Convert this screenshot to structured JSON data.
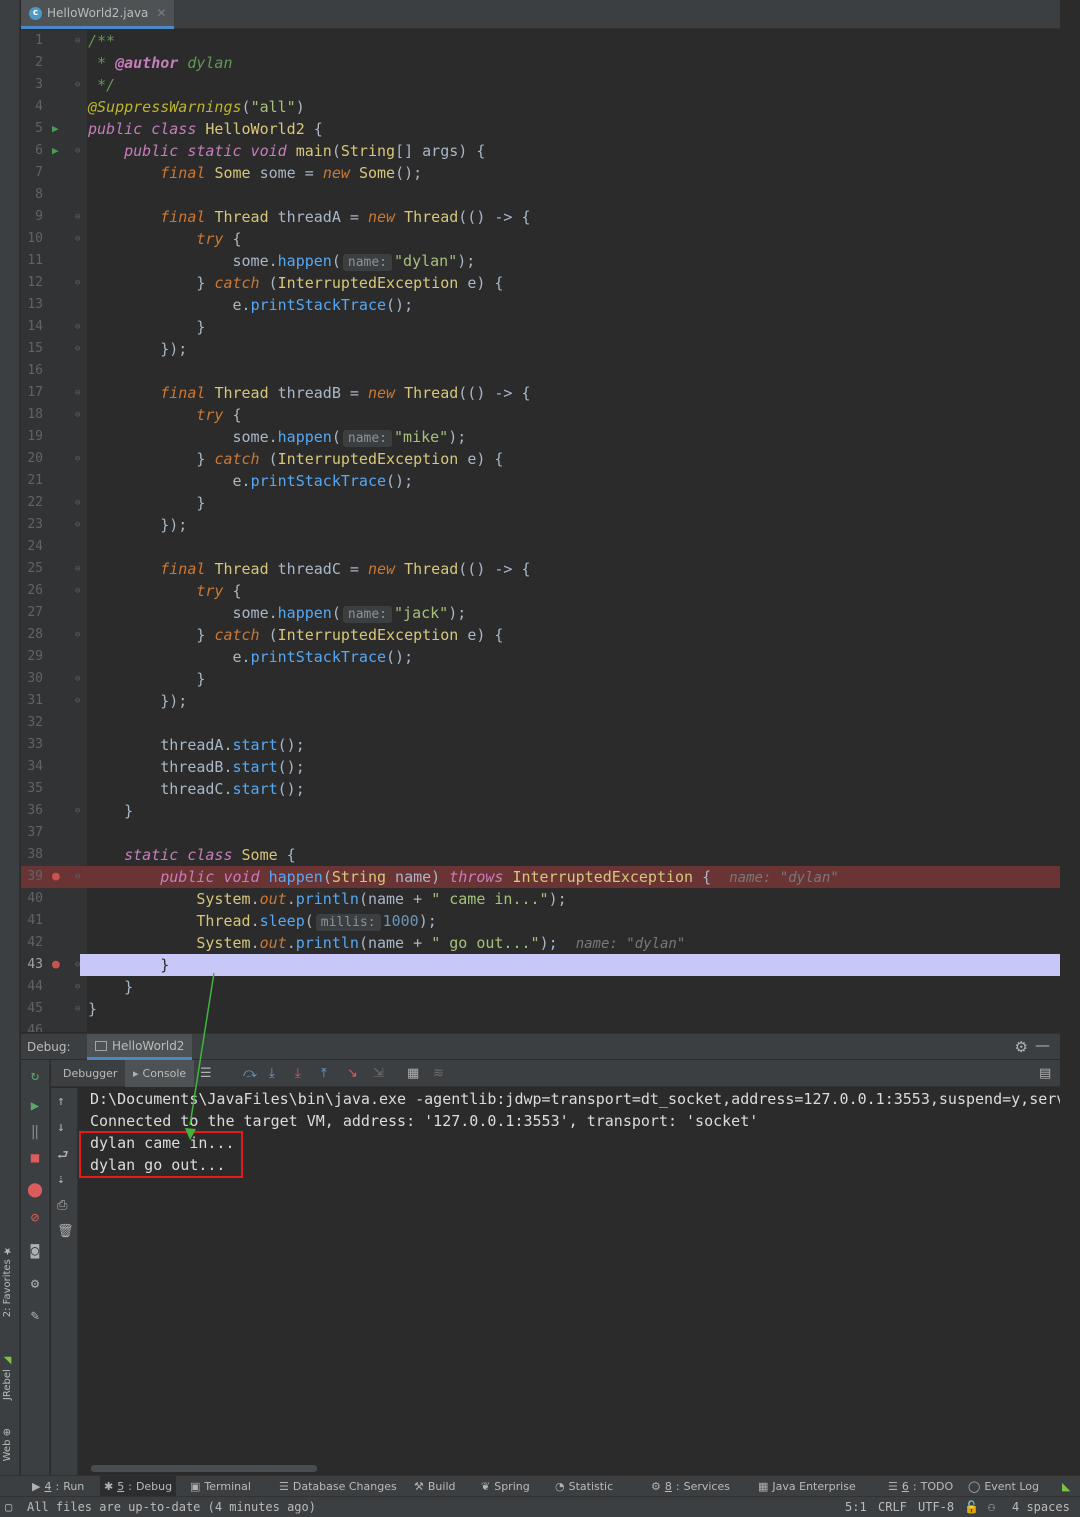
{
  "editor": {
    "tab_label": "HelloWorld2.java",
    "tab_icon": "c",
    "lines": [
      {
        "n": "1"
      },
      {
        "n": "2"
      },
      {
        "n": "3"
      },
      {
        "n": "4"
      },
      {
        "n": "5"
      },
      {
        "n": "6"
      },
      {
        "n": "7"
      },
      {
        "n": "8"
      },
      {
        "n": "9"
      },
      {
        "n": "10"
      },
      {
        "n": "11"
      },
      {
        "n": "12"
      },
      {
        "n": "13"
      },
      {
        "n": "14"
      },
      {
        "n": "15"
      },
      {
        "n": "16"
      },
      {
        "n": "17"
      },
      {
        "n": "18"
      },
      {
        "n": "19"
      },
      {
        "n": "20"
      },
      {
        "n": "21"
      },
      {
        "n": "22"
      },
      {
        "n": "23"
      },
      {
        "n": "24"
      },
      {
        "n": "25"
      },
      {
        "n": "26"
      },
      {
        "n": "27"
      },
      {
        "n": "28"
      },
      {
        "n": "29"
      },
      {
        "n": "30"
      },
      {
        "n": "31"
      },
      {
        "n": "32"
      },
      {
        "n": "33"
      },
      {
        "n": "34"
      },
      {
        "n": "35"
      },
      {
        "n": "36"
      },
      {
        "n": "37"
      },
      {
        "n": "38"
      },
      {
        "n": "39"
      },
      {
        "n": "40"
      },
      {
        "n": "41"
      },
      {
        "n": "42"
      },
      {
        "n": "43"
      },
      {
        "n": "44"
      },
      {
        "n": "45"
      },
      {
        "n": "46"
      }
    ],
    "inlay_name": "name:",
    "inlay_millis": "millis:",
    "inline_value": "name: \"dylan\""
  },
  "debug": {
    "panel_label": "Debug:",
    "config_tab": "HelloWorld2",
    "subtabs": [
      "Debugger",
      "Console"
    ],
    "console_lines": [
      "D:\\Documents\\JavaFiles\\bin\\java.exe -agentlib:jdwp=transport=dt_socket,address=127.0.0.1:3553,suspend=y,serv",
      "Connected to the target VM, address: '127.0.0.1:3553', transport: 'socket'",
      "dylan came in...",
      "dylan go out..."
    ]
  },
  "side_labels": {
    "favorites": "2: Favorites",
    "jrebel": "JRebel",
    "web": "Web"
  },
  "tool_windows": [
    {
      "key": "4",
      "label": "Run",
      "icon": "play-icon"
    },
    {
      "key": "5",
      "label": "Debug",
      "icon": "bug-icon"
    },
    {
      "key": "",
      "label": "Terminal",
      "icon": "terminal-icon"
    },
    {
      "key": "",
      "label": "Database Changes",
      "icon": "database-icon"
    },
    {
      "key": "",
      "label": "Build",
      "icon": "hammer-icon"
    },
    {
      "key": "",
      "label": "Spring",
      "icon": "leaf-icon"
    },
    {
      "key": "",
      "label": "Statistic",
      "icon": "chart-icon"
    },
    {
      "key": "8",
      "label": "Services",
      "icon": "services-icon"
    },
    {
      "key": "",
      "label": "Java Enterprise",
      "icon": "enterprise-icon"
    },
    {
      "key": "6",
      "label": "TODO",
      "icon": "list-icon"
    },
    {
      "key": "",
      "label": "Event Log",
      "icon": "event-log-icon"
    }
  ],
  "status": {
    "message": "All files are up-to-date (4 minutes ago)",
    "position": "5:1",
    "line_sep": "CRLF",
    "encoding": "UTF-8",
    "indent": "4 spaces"
  },
  "colors": {
    "breakpoint_line": "#6b3434",
    "execution_line": "#c7c7f8",
    "highlight_box": "#e8191d",
    "arrow": "#3fb53f"
  }
}
